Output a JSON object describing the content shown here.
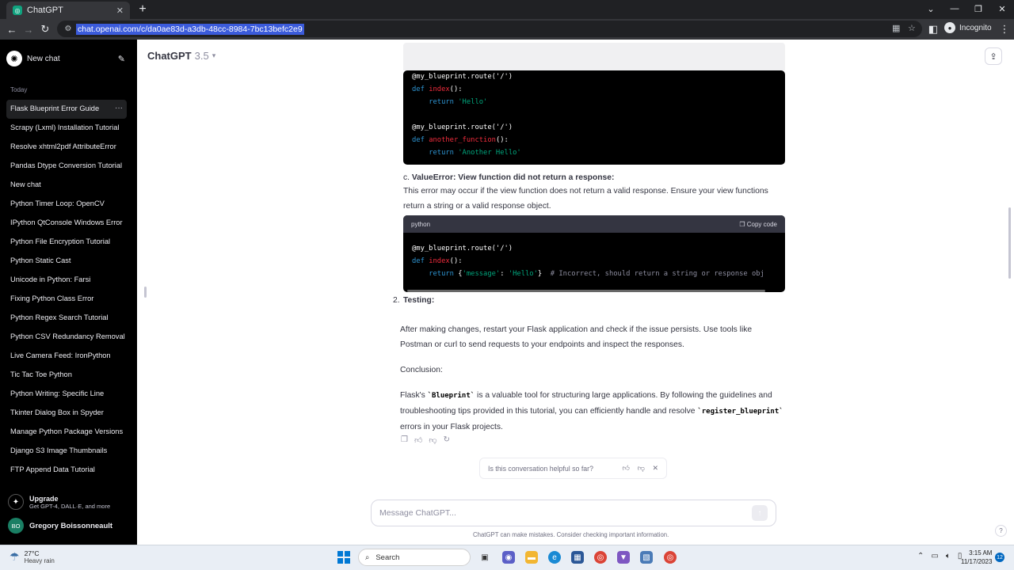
{
  "browser": {
    "tab_title": "ChatGPT",
    "url": "chat.openai.com/c/da0ae83d-a3db-48cc-8984-7bc13befc2e9",
    "profile_label": "Incognito"
  },
  "sidebar": {
    "new_chat_label": "New chat",
    "section_label": "Today",
    "chats": [
      "Flask Blueprint Error Guide",
      "Scrapy (Lxml) Installation Tutorial",
      "Resolve xhtml2pdf AttributeError",
      "Pandas Dtype Conversion Tutorial",
      "New chat",
      "Python Timer Loop: OpenCV",
      "IPython QtConsole Windows Error",
      "Python File Encryption Tutorial",
      "Python Static Cast",
      "Unicode in Python: Farsi",
      "Fixing Python Class Error",
      "Python Regex Search Tutorial",
      "Python CSV Redundancy Removal",
      "Live Camera Feed: IronPython",
      "Tic Tac Toe Python",
      "Python Writing: Specific Line",
      "Tkinter Dialog Box in Spyder",
      "Manage Python Package Versions",
      "Django S3 Image Thumbnails",
      "FTP Append Data Tutorial"
    ],
    "upgrade_title": "Upgrade",
    "upgrade_subtitle": "Get GPT-4, DALL·E, and more",
    "user_initials": "BO",
    "user_name": "Gregory Boissonneault"
  },
  "header": {
    "model_name": "ChatGPT",
    "model_version": "3.5"
  },
  "content": {
    "code1_lines": [
      "@my_blueprint.route('/')",
      "def index():",
      "    return 'Hello'",
      "",
      "@my_blueprint.route('/')",
      "def another_function():",
      "    return 'Another Hello'"
    ],
    "c_prefix": "c. ",
    "c_title": "ValueError: View function did not return a response:",
    "c_paragraph": "This error may occur if the view function does not return a valid response. Ensure your view functions return a string or a valid response object.",
    "code2_lang": "python",
    "code2_copy": "Copy code",
    "code2_lines": [
      "@my_blueprint.route('/')",
      "def index():",
      "    return {'message': 'Hello'}  # Incorrect, should return a string or response obj"
    ],
    "list_number": "2.",
    "testing_title": "Testing:",
    "testing_paragraph": "After making changes, restart your Flask application and check if the issue persists. Use tools like Postman or curl to send requests to your endpoints and inspect the responses.",
    "conclusion_label": "Conclusion:",
    "conclusion_p1": "Flask's ",
    "conclusion_code1": "`Blueprint`",
    "conclusion_p2": " is a valuable tool for structuring large applications. By following the guidelines and troubleshooting tips provided in this tutorial, you can efficiently handle and resolve ",
    "conclusion_code2": "`register_blueprint`",
    "conclusion_p3": " errors in your Flask projects."
  },
  "feedback": {
    "question": "Is this conversation helpful so far?"
  },
  "composer": {
    "placeholder": "Message ChatGPT...",
    "disclaimer": "ChatGPT can make mistakes. Consider checking important information."
  },
  "taskbar": {
    "temperature": "27°C",
    "weather": "Heavy rain",
    "search_label": "Search",
    "time": "3:15 AM",
    "date": "11/17/2023",
    "notifications": "12"
  },
  "colors": {
    "sidebar_bg": "#000000",
    "code_bg": "#000000",
    "keyword": "#2e95d3",
    "function": "#f22c3d",
    "string": "#00a67d"
  }
}
